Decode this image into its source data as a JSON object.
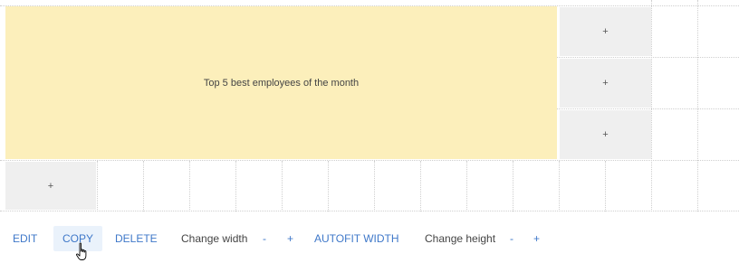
{
  "widget": {
    "title": "Top 5 best employees of the month"
  },
  "grid": {
    "add_symbol": "+"
  },
  "toolbar": {
    "edit": "EDIT",
    "copy": "COPY",
    "delete": "DELETE",
    "change_width": "Change width",
    "width_minus": "-",
    "width_plus": "+",
    "autofit_width": "AUTOFIT WIDTH",
    "change_height": "Change height",
    "height_minus": "-",
    "height_plus": "+"
  },
  "icons": {
    "cursor": "hand-pointer-icon"
  }
}
